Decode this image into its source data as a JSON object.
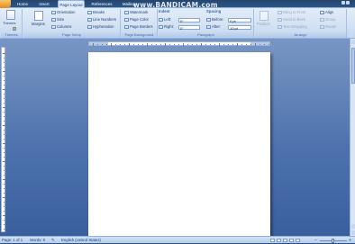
{
  "tabs": [
    "Home",
    "Insert",
    "Page Layout",
    "References",
    "Mailings"
  ],
  "active_tab": "Page Layout",
  "watermark": "www.BANDICAM.com",
  "ribbon": {
    "themes": {
      "label": "Themes",
      "button": "Themes"
    },
    "page_setup": {
      "label": "Page Setup",
      "margins": "Margins",
      "orientation": "Orientation",
      "size": "Size",
      "columns": "Columns",
      "breaks": "Breaks",
      "line_numbers": "Line Numbers",
      "hyphenation": "Hyphenation"
    },
    "page_background": {
      "label": "Page Background",
      "watermark": "Watermark",
      "page_color": "Page Color",
      "page_borders": "Page Borders"
    },
    "paragraph": {
      "label": "Paragraph",
      "indent_title": "Indent",
      "indent_left_label": "Left:",
      "indent_left_value": "0\"",
      "indent_right_label": "Right:",
      "indent_right_value": "0\"",
      "spacing_title": "Spacing",
      "before_label": "Before:",
      "before_value": "0 pt",
      "after_label": "After:",
      "after_value": "10 pt"
    },
    "arrange": {
      "label": "Arrange",
      "position": "Position",
      "bring_to_front": "Bring to Front",
      "send_to_back": "Send to Back",
      "text_wrapping": "Text Wrapping",
      "align": "Align",
      "group": "Group",
      "rotate": "Rotate"
    }
  },
  "status": {
    "page": "Page: 1 of 1",
    "words": "Words: 0",
    "language": "English (United States)"
  }
}
